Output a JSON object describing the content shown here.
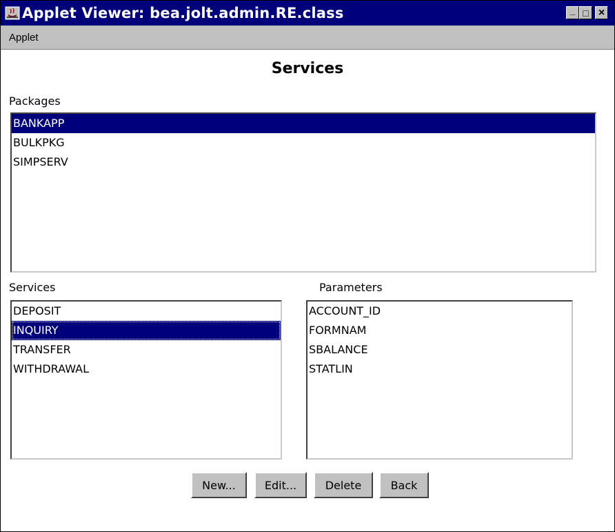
{
  "window": {
    "title": "Applet Viewer: bea.jolt.admin.RE.class",
    "controls": {
      "minimize": "_",
      "maximize": "□",
      "close": "×"
    }
  },
  "menubar": {
    "items": [
      {
        "label": "Applet"
      }
    ]
  },
  "heading": "Services",
  "packages": {
    "label": "Packages",
    "items": [
      "BANKAPP",
      "BULKPKG",
      "SIMPSERV"
    ],
    "selected": "BANKAPP"
  },
  "services": {
    "label": "Services",
    "items": [
      "DEPOSIT",
      "INQUIRY",
      "TRANSFER",
      "WITHDRAWAL"
    ],
    "selected": "INQUIRY"
  },
  "parameters": {
    "label": "Parameters",
    "items": [
      "ACCOUNT_ID",
      "FORMNAM",
      "SBALANCE",
      "STATLIN"
    ]
  },
  "buttons": {
    "new": "New...",
    "edit": "Edit...",
    "delete": "Delete",
    "back": "Back"
  },
  "colors": {
    "titlebar": "#00007b",
    "selection": "#00007b",
    "face": "#c0c0c0"
  },
  "icons": {
    "app": "java-applet-icon"
  }
}
